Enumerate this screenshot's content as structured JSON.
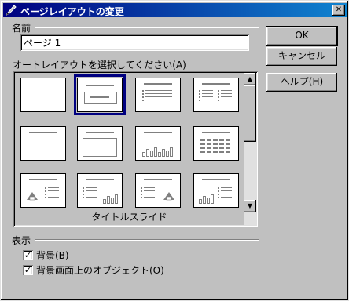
{
  "window": {
    "title": "ページレイアウトの変更",
    "close_glyph": "✕"
  },
  "name_section": {
    "label": "名前",
    "value": "ページ 1"
  },
  "buttons": {
    "ok": "OK",
    "cancel": "キャンセル",
    "help": "ヘルプ(H)"
  },
  "autolayout": {
    "label": "オートレイアウトを選択してください(A)",
    "selected_caption": "タイトルスライド",
    "layouts": [
      {
        "kind": "blank"
      },
      {
        "kind": "title-slide",
        "selected": true
      },
      {
        "kind": "title-bullets"
      },
      {
        "kind": "title-two-columns-bullets"
      },
      {
        "kind": "title-only"
      },
      {
        "kind": "title-content-box"
      },
      {
        "kind": "title-chart"
      },
      {
        "kind": "title-table"
      },
      {
        "kind": "clipart-bullets"
      },
      {
        "kind": "bullets-chart"
      },
      {
        "kind": "bullets-clipart"
      },
      {
        "kind": "chart-bullets"
      }
    ],
    "scroll_up_glyph": "▲",
    "scroll_down_glyph": "▼"
  },
  "display": {
    "label": "表示",
    "options": [
      {
        "label": "背景(B)",
        "checked": true
      },
      {
        "label": "背景画面上のオブジェクト(O)",
        "checked": true
      }
    ],
    "check_glyph": "✓"
  }
}
